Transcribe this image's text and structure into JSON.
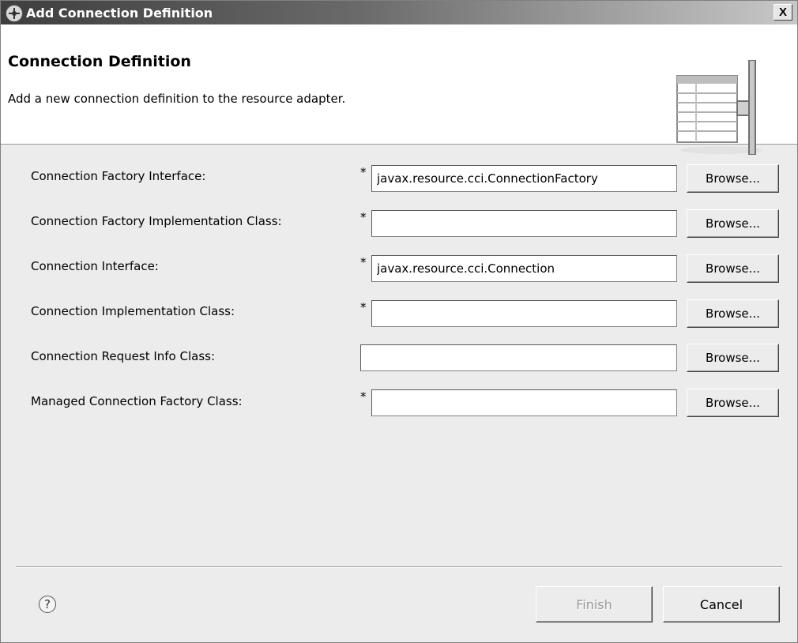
{
  "window": {
    "title": "Add Connection Definition",
    "close_label": "X"
  },
  "banner": {
    "title": "Connection Definition",
    "description": "Add a new connection definition to the resource adapter."
  },
  "form": {
    "required_marker": "*",
    "rows": [
      {
        "label": "Connection Factory Interface:",
        "value": "javax.resource.cci.ConnectionFactory",
        "required": true,
        "browse_label": "Browse..."
      },
      {
        "label": "Connection Factory Implementation Class:",
        "value": "",
        "required": true,
        "browse_label": "Browse..."
      },
      {
        "label": "Connection Interface:",
        "value": "javax.resource.cci.Connection",
        "required": true,
        "browse_label": "Browse..."
      },
      {
        "label": "Connection Implementation Class:",
        "value": "",
        "required": true,
        "browse_label": "Browse..."
      },
      {
        "label": "Connection Request Info Class:",
        "value": "",
        "required": false,
        "browse_label": "Browse..."
      },
      {
        "label": "Managed Connection Factory Class:",
        "value": "",
        "required": true,
        "browse_label": "Browse..."
      }
    ]
  },
  "footer": {
    "help_label": "?",
    "finish_label": "Finish",
    "cancel_label": "Cancel",
    "finish_enabled": false
  },
  "icons": {
    "app": "app-icon",
    "close": "close-icon",
    "help": "help-icon",
    "banner": "table-plug-icon"
  }
}
